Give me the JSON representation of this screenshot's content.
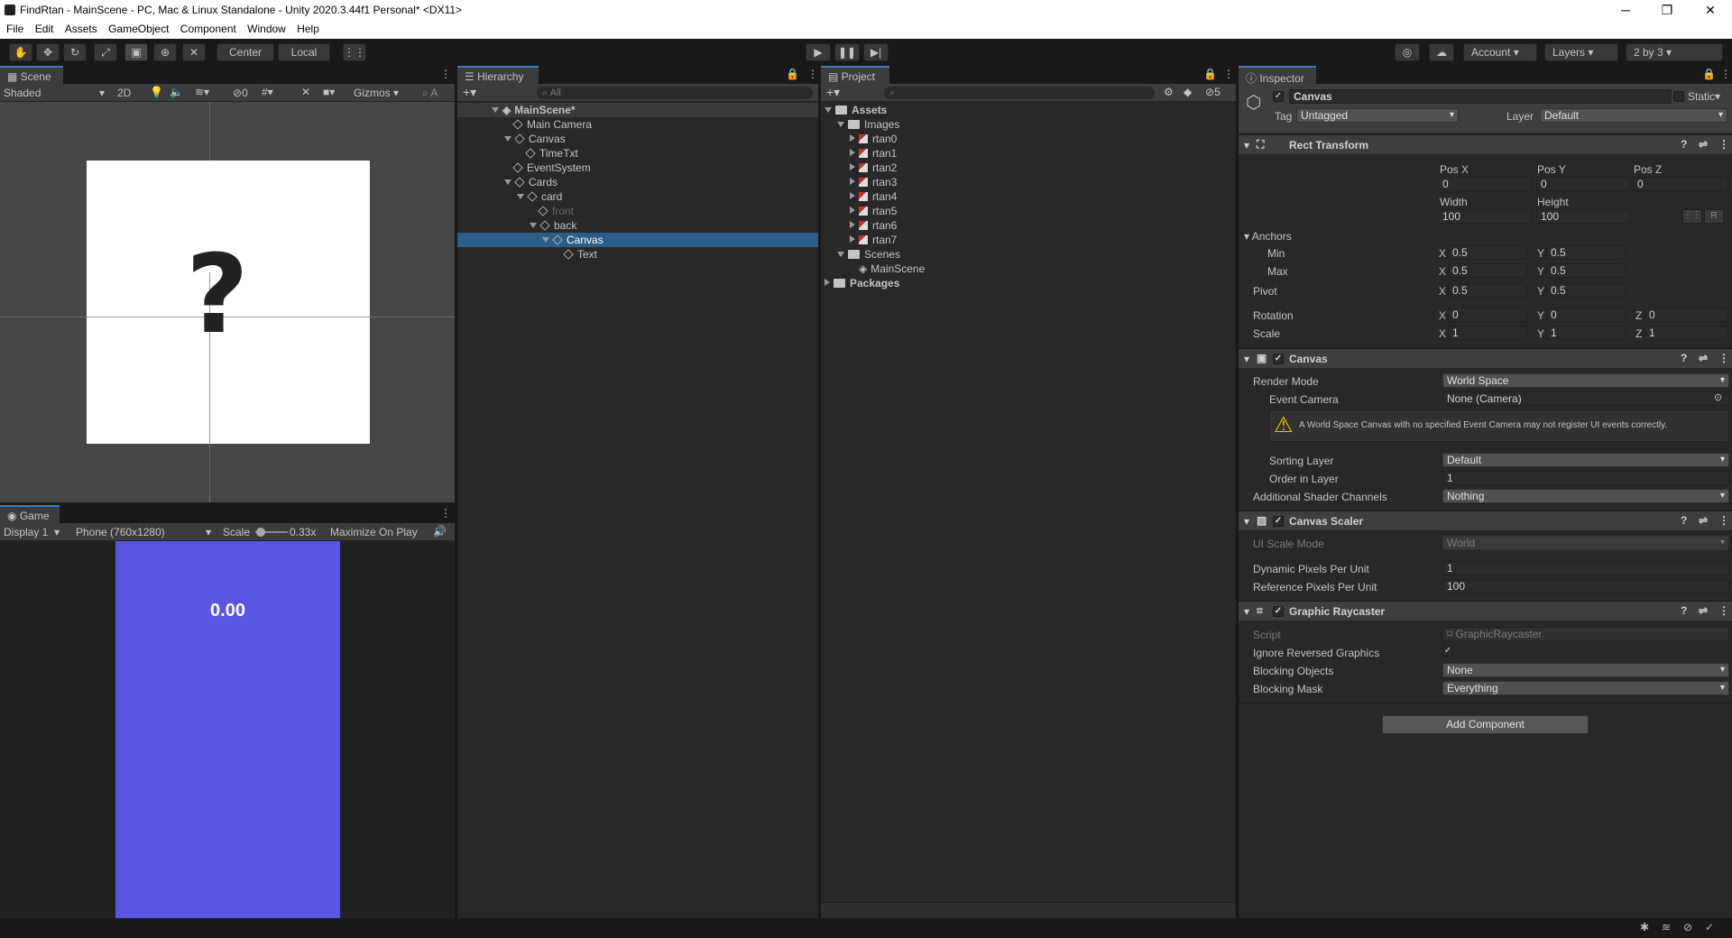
{
  "window": {
    "title": "FindRtan - MainScene - PC, Mac & Linux Standalone - Unity 2020.3.44f1 Personal* <DX11>"
  },
  "menu": [
    "File",
    "Edit",
    "Assets",
    "GameObject",
    "Component",
    "Window",
    "Help"
  ],
  "toolbar": {
    "center": "Center",
    "local": "Local",
    "account": "Account",
    "layers": "Layers",
    "layout": "2 by 3"
  },
  "scene": {
    "tab": "Scene",
    "shading": "Shaded",
    "mode2d": "2D",
    "hidden_count": "0",
    "gizmos": "Gizmos",
    "search": "All",
    "card_glyph": "?"
  },
  "game": {
    "tab": "Game",
    "display": "Display 1",
    "resolution": "Phone (760x1280)",
    "scale_label": "Scale",
    "scale_value": "0.33x",
    "maximize": "Maximize On Play",
    "timer": "0.00",
    "bg": "#5856e3"
  },
  "hierarchy": {
    "tab": "Hierarchy",
    "search": "All",
    "items": [
      {
        "label": "MainScene*",
        "depth": 0,
        "fold": "open",
        "scene": true
      },
      {
        "label": "Main Camera",
        "depth": 1,
        "fold": "none"
      },
      {
        "label": "Canvas",
        "depth": 1,
        "fold": "open"
      },
      {
        "label": "TimeTxt",
        "depth": 2,
        "fold": "none"
      },
      {
        "label": "EventSystem",
        "depth": 1,
        "fold": "none"
      },
      {
        "label": "Cards",
        "depth": 1,
        "fold": "open"
      },
      {
        "label": "card",
        "depth": 2,
        "fold": "open"
      },
      {
        "label": "front",
        "depth": 3,
        "fold": "none",
        "disabled": true
      },
      {
        "label": "back",
        "depth": 3,
        "fold": "open"
      },
      {
        "label": "Canvas",
        "depth": 4,
        "fold": "open",
        "selected": true
      },
      {
        "label": "Text",
        "depth": 5,
        "fold": "none"
      }
    ]
  },
  "project": {
    "tab": "Project",
    "hidden_count": "5",
    "items": [
      {
        "label": "Assets",
        "depth": 0,
        "type": "folder",
        "fold": "open",
        "bold": true
      },
      {
        "label": "Images",
        "depth": 1,
        "type": "folder",
        "fold": "open"
      },
      {
        "label": "rtan0",
        "depth": 2,
        "type": "sprite",
        "fold": "closed"
      },
      {
        "label": "rtan1",
        "depth": 2,
        "type": "sprite",
        "fold": "closed"
      },
      {
        "label": "rtan2",
        "depth": 2,
        "type": "sprite",
        "fold": "closed"
      },
      {
        "label": "rtan3",
        "depth": 2,
        "type": "sprite",
        "fold": "closed"
      },
      {
        "label": "rtan4",
        "depth": 2,
        "type": "sprite",
        "fold": "closed"
      },
      {
        "label": "rtan5",
        "depth": 2,
        "type": "sprite",
        "fold": "closed"
      },
      {
        "label": "rtan6",
        "depth": 2,
        "type": "sprite",
        "fold": "closed"
      },
      {
        "label": "rtan7",
        "depth": 2,
        "type": "sprite",
        "fold": "closed"
      },
      {
        "label": "Scenes",
        "depth": 1,
        "type": "folder",
        "fold": "open"
      },
      {
        "label": "MainScene",
        "depth": 2,
        "type": "scene",
        "fold": "none"
      },
      {
        "label": "Packages",
        "depth": 0,
        "type": "folder",
        "fold": "closed",
        "bold": true
      }
    ]
  },
  "inspector": {
    "tab": "Inspector",
    "object_name": "Canvas",
    "static": "Static",
    "tag_label": "Tag",
    "tag": "Untagged",
    "layer_label": "Layer",
    "layer": "Default",
    "rect": {
      "title": "Rect Transform",
      "posx_l": "Pos X",
      "posy_l": "Pos Y",
      "posz_l": "Pos Z",
      "posx": "0",
      "posy": "0",
      "posz": "0",
      "width_l": "Width",
      "height_l": "Height",
      "width": "100",
      "height": "100",
      "r": "R",
      "anchors": "Anchors",
      "min": "Min",
      "max": "Max",
      "pivot": "Pivot",
      "rotation": "Rotation",
      "scale": "Scale",
      "x": "X",
      "y": "Y",
      "z": "Z",
      "min_x": "0.5",
      "min_y": "0.5",
      "max_x": "0.5",
      "max_y": "0.5",
      "pivot_x": "0.5",
      "pivot_y": "0.5",
      "rot_x": "0",
      "rot_y": "0",
      "rot_z": "0",
      "scale_x": "1",
      "scale_y": "1",
      "scale_z": "1"
    },
    "canvas": {
      "title": "Canvas",
      "render_mode_l": "Render Mode",
      "render_mode": "World Space",
      "event_camera_l": "Event Camera",
      "event_camera": "None (Camera)",
      "warning": "A World Space Canvas with no specified Event Camera may not register UI events correctly.",
      "sorting_layer_l": "Sorting Layer",
      "sorting_layer": "Default",
      "order_l": "Order in Layer",
      "order": "1",
      "shader_l": "Additional Shader Channels",
      "shader": "Nothing"
    },
    "scaler": {
      "title": "Canvas Scaler",
      "mode_l": "UI Scale Mode",
      "mode": "World",
      "dpu_l": "Dynamic Pixels Per Unit",
      "dpu": "1",
      "rpu_l": "Reference Pixels Per Unit",
      "rpu": "100"
    },
    "raycaster": {
      "title": "Graphic Raycaster",
      "script_l": "Script",
      "script": "GraphicRaycaster",
      "ignore_l": "Ignore Reversed Graphics",
      "blocking_l": "Blocking Objects",
      "blocking": "None",
      "mask_l": "Blocking Mask",
      "mask": "Everything"
    },
    "add_component": "Add Component"
  }
}
